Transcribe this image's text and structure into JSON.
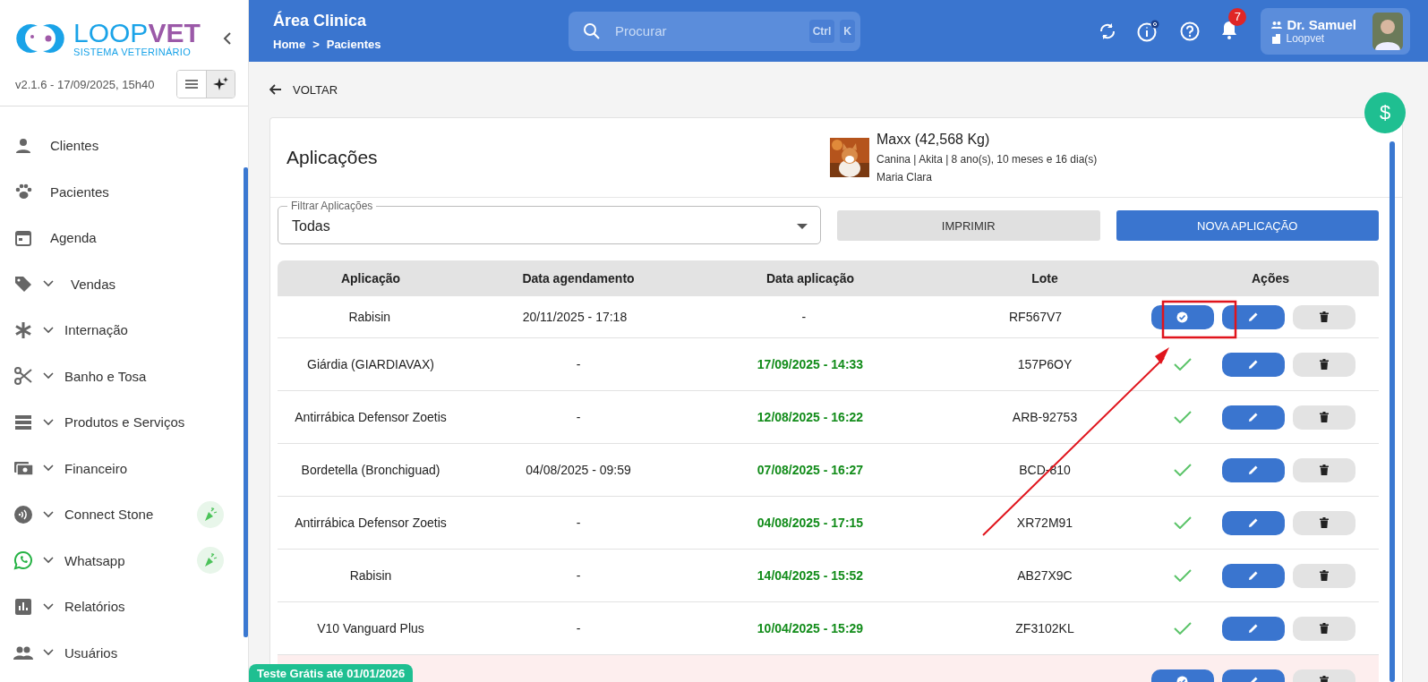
{
  "sidebar": {
    "brand": "LOOP",
    "brand_accent": "VET",
    "tagline": "SISTEMA VETERINÁRIO",
    "version": "v2.1.6 - 17/09/2025, 15h40",
    "items": [
      {
        "label": "Clientes",
        "expandable": false,
        "badge": false
      },
      {
        "label": "Pacientes",
        "expandable": false,
        "badge": false
      },
      {
        "label": "Agenda",
        "expandable": false,
        "badge": false
      },
      {
        "label": "Vendas",
        "expandable": true,
        "badge": false
      },
      {
        "label": "Internação",
        "expandable": true,
        "badge": false
      },
      {
        "label": "Banho e Tosa",
        "expandable": true,
        "badge": false
      },
      {
        "label": "Produtos e Serviços",
        "expandable": true,
        "badge": false
      },
      {
        "label": "Financeiro",
        "expandable": true,
        "badge": false
      },
      {
        "label": "Connect Stone",
        "expandable": true,
        "badge": true
      },
      {
        "label": "Whatsapp",
        "expandable": true,
        "badge": true
      },
      {
        "label": "Relatórios",
        "expandable": true,
        "badge": false
      },
      {
        "label": "Usuários",
        "expandable": true,
        "badge": false
      }
    ]
  },
  "header": {
    "title": "Área Clinica",
    "breadcrumb": [
      "Home",
      ">",
      "Pacientes"
    ],
    "search": {
      "placeholder": "Procurar",
      "keys": [
        "Ctrl",
        "K"
      ]
    },
    "notifications": "7",
    "user": {
      "name": "Dr. Samuel",
      "org": "Loopvet"
    }
  },
  "back": "VOLTAR",
  "fab": "$",
  "card": {
    "title": "Aplicações",
    "pet": {
      "name": "Maxx (42,568 Kg)",
      "details": "Canina | Akita | 8 ano(s), 10 meses e 16 dia(s)",
      "owner": "Maria Clara"
    },
    "filter": {
      "label": "Filtrar Aplicações",
      "value": "Todas"
    },
    "print": "IMPRIMIR",
    "new": "NOVA APLICAÇÃO",
    "columns": [
      "Aplicação",
      "Data agendamento",
      "Data aplicação",
      "Lote",
      "Ações"
    ],
    "rows": [
      {
        "name": "Rabisin",
        "scheduled": "20/11/2025 - 17:18",
        "applied_at": "-",
        "lot": "RF567V7",
        "applied": false,
        "overdue": false
      },
      {
        "name": "Giárdia (GIARDIAVAX)",
        "scheduled": "-",
        "applied_at": "17/09/2025 - 14:33",
        "lot": "157P6OY",
        "applied": true,
        "overdue": false
      },
      {
        "name": "Antirrábica Defensor Zoetis",
        "scheduled": "-",
        "applied_at": "12/08/2025 - 16:22",
        "lot": "ARB-92753",
        "applied": true,
        "overdue": false
      },
      {
        "name": "Bordetella (Bronchiguad)",
        "scheduled": "04/08/2025 - 09:59",
        "applied_at": "07/08/2025 - 16:27",
        "lot": "BCD-810",
        "applied": true,
        "overdue": false
      },
      {
        "name": "Antirrábica Defensor Zoetis",
        "scheduled": "-",
        "applied_at": "04/08/2025 - 17:15",
        "lot": "XR72M91",
        "applied": true,
        "overdue": false
      },
      {
        "name": "Rabisin",
        "scheduled": "-",
        "applied_at": "14/04/2025 - 15:52",
        "lot": "AB27X9C",
        "applied": true,
        "overdue": false
      },
      {
        "name": "V10 Vanguard Plus",
        "scheduled": "-",
        "applied_at": "10/04/2025 - 15:29",
        "lot": "ZF3102KL",
        "applied": true,
        "overdue": false
      },
      {
        "applied": false,
        "overdue": true
      }
    ]
  },
  "trial": "Teste Grátis até 01/01/2026"
}
